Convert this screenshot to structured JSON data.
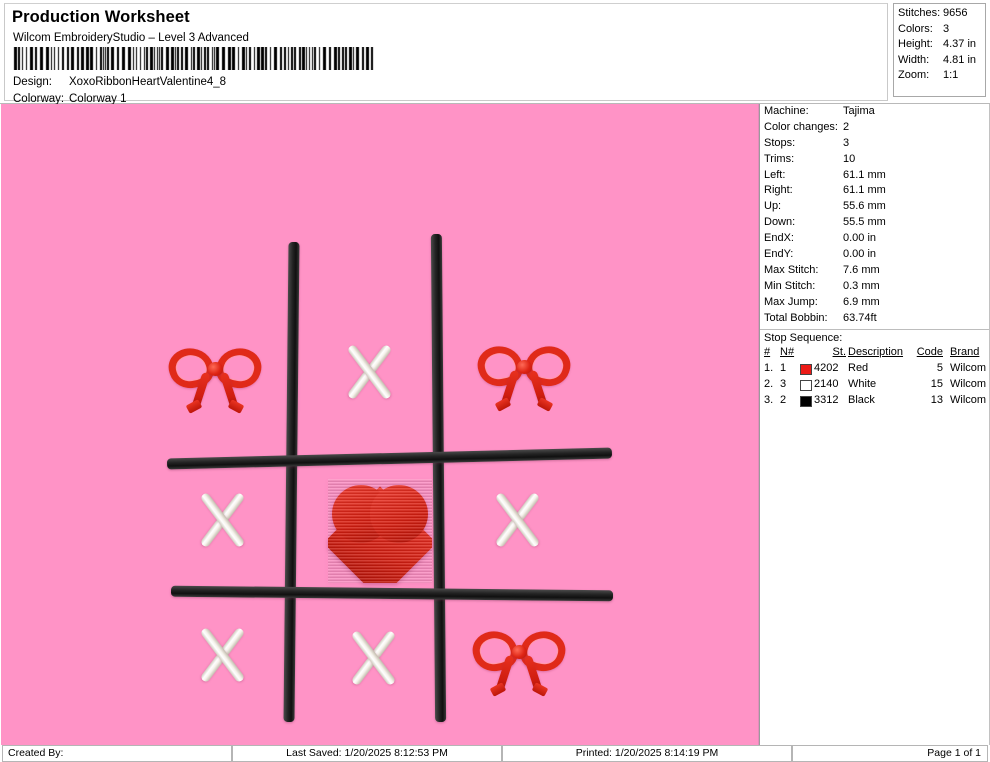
{
  "header": {
    "title": "Production Worksheet",
    "subtitle": "Wilcom EmbroideryStudio – Level 3 Advanced",
    "barcode_name": "barcode",
    "design_label": "Design:",
    "design_value": "XoxoRibbonHeartValentine4_8",
    "colorway_label": "Colorway:",
    "colorway_value": "Colorway 1"
  },
  "stats": [
    {
      "label": "Stitches:",
      "value": "9656"
    },
    {
      "label": "Colors:",
      "value": "3"
    },
    {
      "label": "Height:",
      "value": "4.37 in"
    },
    {
      "label": "Width:",
      "value": "4.81 in"
    },
    {
      "label": "Zoom:",
      "value": "1:1"
    }
  ],
  "machine_info": [
    {
      "label": "Machine:",
      "value": "Tajima"
    },
    {
      "label": "Color changes:",
      "value": "2"
    },
    {
      "label": "Stops:",
      "value": "3"
    },
    {
      "label": "Trims:",
      "value": "10"
    },
    {
      "label": "Left:",
      "value": "61.1 mm"
    },
    {
      "label": "Right:",
      "value": "61.1 mm"
    },
    {
      "label": "Up:",
      "value": "55.6 mm"
    },
    {
      "label": "Down:",
      "value": "55.5 mm"
    },
    {
      "label": "EndX:",
      "value": "0.00 in"
    },
    {
      "label": "EndY:",
      "value": "0.00 in"
    },
    {
      "label": "Max Stitch:",
      "value": "7.6 mm"
    },
    {
      "label": "Min Stitch:",
      "value": "0.3 mm"
    },
    {
      "label": "Max Jump:",
      "value": "6.9 mm"
    },
    {
      "label": "Total Bobbin:",
      "value": "63.74ft"
    }
  ],
  "stop_sequence": {
    "section_title": "Stop Sequence:",
    "columns": {
      "num": "#",
      "needle": "N#",
      "stitches": "St.",
      "description": "Description",
      "code": "Code",
      "brand": "Brand"
    },
    "rows": [
      {
        "num": "1.",
        "needle": "1",
        "swatch": "#ec1b17",
        "stitches": "4202",
        "description": "Red",
        "code": "5",
        "brand": "Wilcom"
      },
      {
        "num": "2.",
        "needle": "3",
        "swatch": "#ffffff",
        "stitches": "2140",
        "description": "White",
        "code": "15",
        "brand": "Wilcom"
      },
      {
        "num": "3.",
        "needle": "2",
        "swatch": "#000000",
        "stitches": "3312",
        "description": "Black",
        "code": "13",
        "brand": "Wilcom"
      }
    ]
  },
  "design": {
    "background_color": "#ff93c6",
    "thread_red": "#e02a19",
    "thread_white": "#f4f1e9",
    "thread_black": "#1a1a1a",
    "cells": [
      {
        "row": 1,
        "col": 1,
        "motif": "bow"
      },
      {
        "row": 1,
        "col": 2,
        "motif": "x"
      },
      {
        "row": 1,
        "col": 3,
        "motif": "bow"
      },
      {
        "row": 2,
        "col": 1,
        "motif": "x"
      },
      {
        "row": 2,
        "col": 2,
        "motif": "heart"
      },
      {
        "row": 2,
        "col": 3,
        "motif": "x"
      },
      {
        "row": 3,
        "col": 1,
        "motif": "x"
      },
      {
        "row": 3,
        "col": 2,
        "motif": "x"
      },
      {
        "row": 3,
        "col": 3,
        "motif": "bow"
      }
    ]
  },
  "footer": {
    "created_by": "Created By:",
    "last_saved": "Last Saved: 1/20/2025 8:12:53 PM",
    "printed": "Printed: 1/20/2025 8:14:19 PM",
    "page": "Page 1 of 1"
  }
}
